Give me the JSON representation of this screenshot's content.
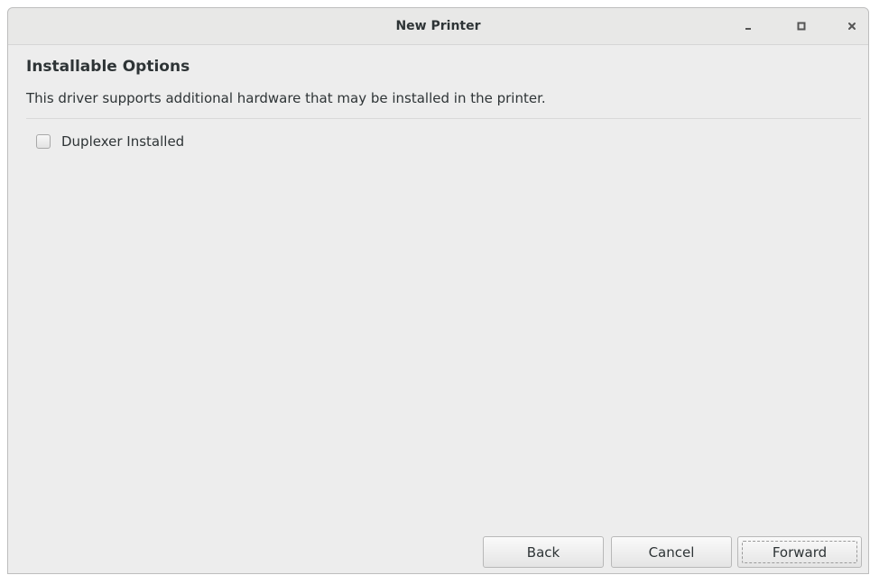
{
  "window": {
    "title": "New Printer",
    "controls": {
      "minimize_icon": "minimize-icon",
      "maximize_icon": "maximize-icon",
      "close_icon": "close-icon"
    }
  },
  "page": {
    "heading": "Installable Options",
    "description": "This driver supports additional hardware that may be installed in the printer."
  },
  "options": [
    {
      "label": "Duplexer Installed",
      "checked": false
    }
  ],
  "buttons": {
    "back": "Back",
    "cancel": "Cancel",
    "forward": "Forward"
  },
  "colors": {
    "window_bg": "#ededed",
    "text": "#2e3436",
    "border": "#b8b8b8"
  }
}
